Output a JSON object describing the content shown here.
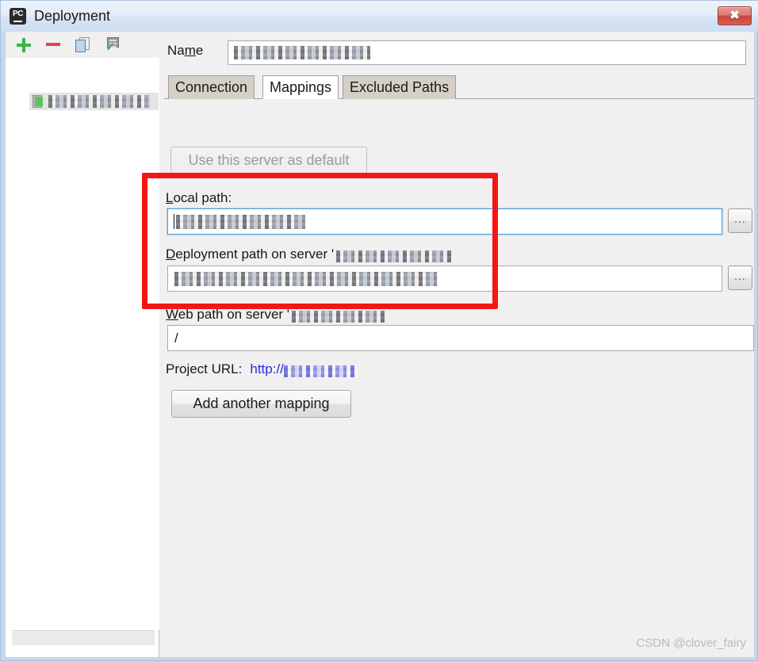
{
  "window": {
    "title": "Deployment",
    "app_icon": "pycharm-icon",
    "app_icon_text": "PC",
    "close_label": "✖"
  },
  "sidebar": {
    "toolbar": [
      {
        "name": "add-server-button",
        "icon": "plus-icon",
        "tooltip": "Add"
      },
      {
        "name": "remove-server-button",
        "icon": "minus-icon",
        "tooltip": "Remove"
      },
      {
        "name": "copy-server-button",
        "icon": "copy-icon",
        "tooltip": "Copy"
      },
      {
        "name": "set-default-server-button",
        "icon": "server-check-icon",
        "tooltip": "Use as default"
      }
    ],
    "items": [
      {
        "name": "server-tree-item",
        "icon": "server-icon",
        "label": "",
        "redacted": true,
        "selected": true
      }
    ]
  },
  "form": {
    "name_label": "Na",
    "name_label_mnemonic": "m",
    "name_label_rest": "e",
    "name_value": "",
    "name_value_redacted": true,
    "name_placeholder": ""
  },
  "tabs": [
    {
      "label": "Connection",
      "active": false
    },
    {
      "label": "Mappings",
      "active": true
    },
    {
      "label": "Excluded Paths",
      "active": false
    }
  ],
  "mappings": {
    "use_default_button": "Use this server as default",
    "use_default_disabled": true,
    "local_path": {
      "label_mnemonic": "L",
      "label_rest": "ocal path:",
      "value": "",
      "value_redacted": true,
      "focused": true,
      "browse_label": "..."
    },
    "deployment_path": {
      "label_mnemonic": "D",
      "label_rest": "eployment path on server '",
      "label_server_redacted": true,
      "value": "",
      "value_redacted": true,
      "browse_label": "..."
    },
    "web_path": {
      "label_mnemonic": "W",
      "label_rest": "eb path on server '",
      "label_server_redacted": true,
      "value": "/"
    },
    "project_url": {
      "label": "Project URL:",
      "scheme": "http://",
      "host_redacted": true
    },
    "add_mapping_button": "Add another mapping"
  },
  "annotation": {
    "type": "highlight-rectangle",
    "color": "#f41616"
  },
  "watermark": {
    "text": "CSDN @clover_fairy"
  },
  "colors": {
    "accent_link": "#2b2bd4",
    "annotation_red": "#f41616",
    "window_frame": "#c5d7ee",
    "panel_bg": "#f0f0f0",
    "close_button": "#c9463b"
  }
}
